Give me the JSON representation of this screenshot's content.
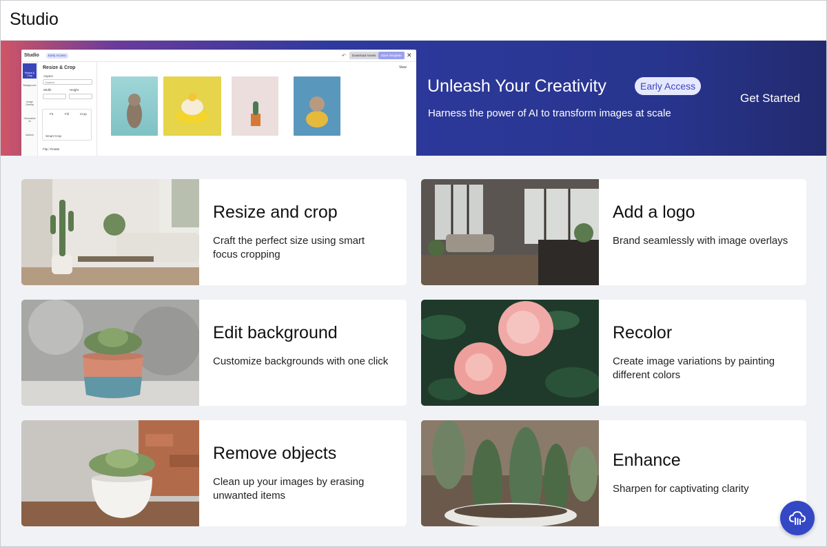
{
  "app": {
    "title": "Studio"
  },
  "hero": {
    "title": "Unleash Your Creativity",
    "badge": "Early Access",
    "subtitle": "Harness the power of AI to transform images at scale",
    "cta": "Get Started",
    "preview": {
      "logo": "Studio",
      "badge": "Early Access",
      "download_label": "Download Assets",
      "save_label": "Save Template",
      "panel_title": "Resize & Crop",
      "aspect_label": "Aspect",
      "aspect_value": "Custom",
      "width_label": "Width",
      "height_label": "Height",
      "mode_fit": "Fit",
      "mode_fill": "Fill",
      "mode_crop": "Crop",
      "smart_crop": "Smart Crop",
      "flip_rotate": "Flip / Rotate",
      "view_label": "View",
      "rail": [
        "Resize & Crop",
        "Background",
        "Image Overlay",
        "Generative AI",
        "Addons"
      ]
    }
  },
  "cards": [
    {
      "title": "Resize and crop",
      "description": "Craft the perfect size using smart focus cropping",
      "image": "living-room-cactus"
    },
    {
      "title": "Add a logo",
      "description": "Brand seamlessly with image overlays",
      "image": "loft-interior"
    },
    {
      "title": "Edit background",
      "description": "Customize backgrounds with one click",
      "image": "succulent-pot"
    },
    {
      "title": "Recolor",
      "description": "Create image variations by painting different colors",
      "image": "pink-peonies"
    },
    {
      "title": "Remove objects",
      "description": "Clean up your images by erasing unwanted items",
      "image": "succulent-white-pot"
    },
    {
      "title": "Enhance",
      "description": "Sharpen for captivating clarity",
      "image": "cactus-closeup"
    }
  ],
  "fab": {
    "icon": "cloud-icon"
  },
  "colors": {
    "accent": "#3448c5",
    "hero_start": "#cf5566",
    "hero_end": "#222a6e",
    "background": "#f1f2f6"
  }
}
